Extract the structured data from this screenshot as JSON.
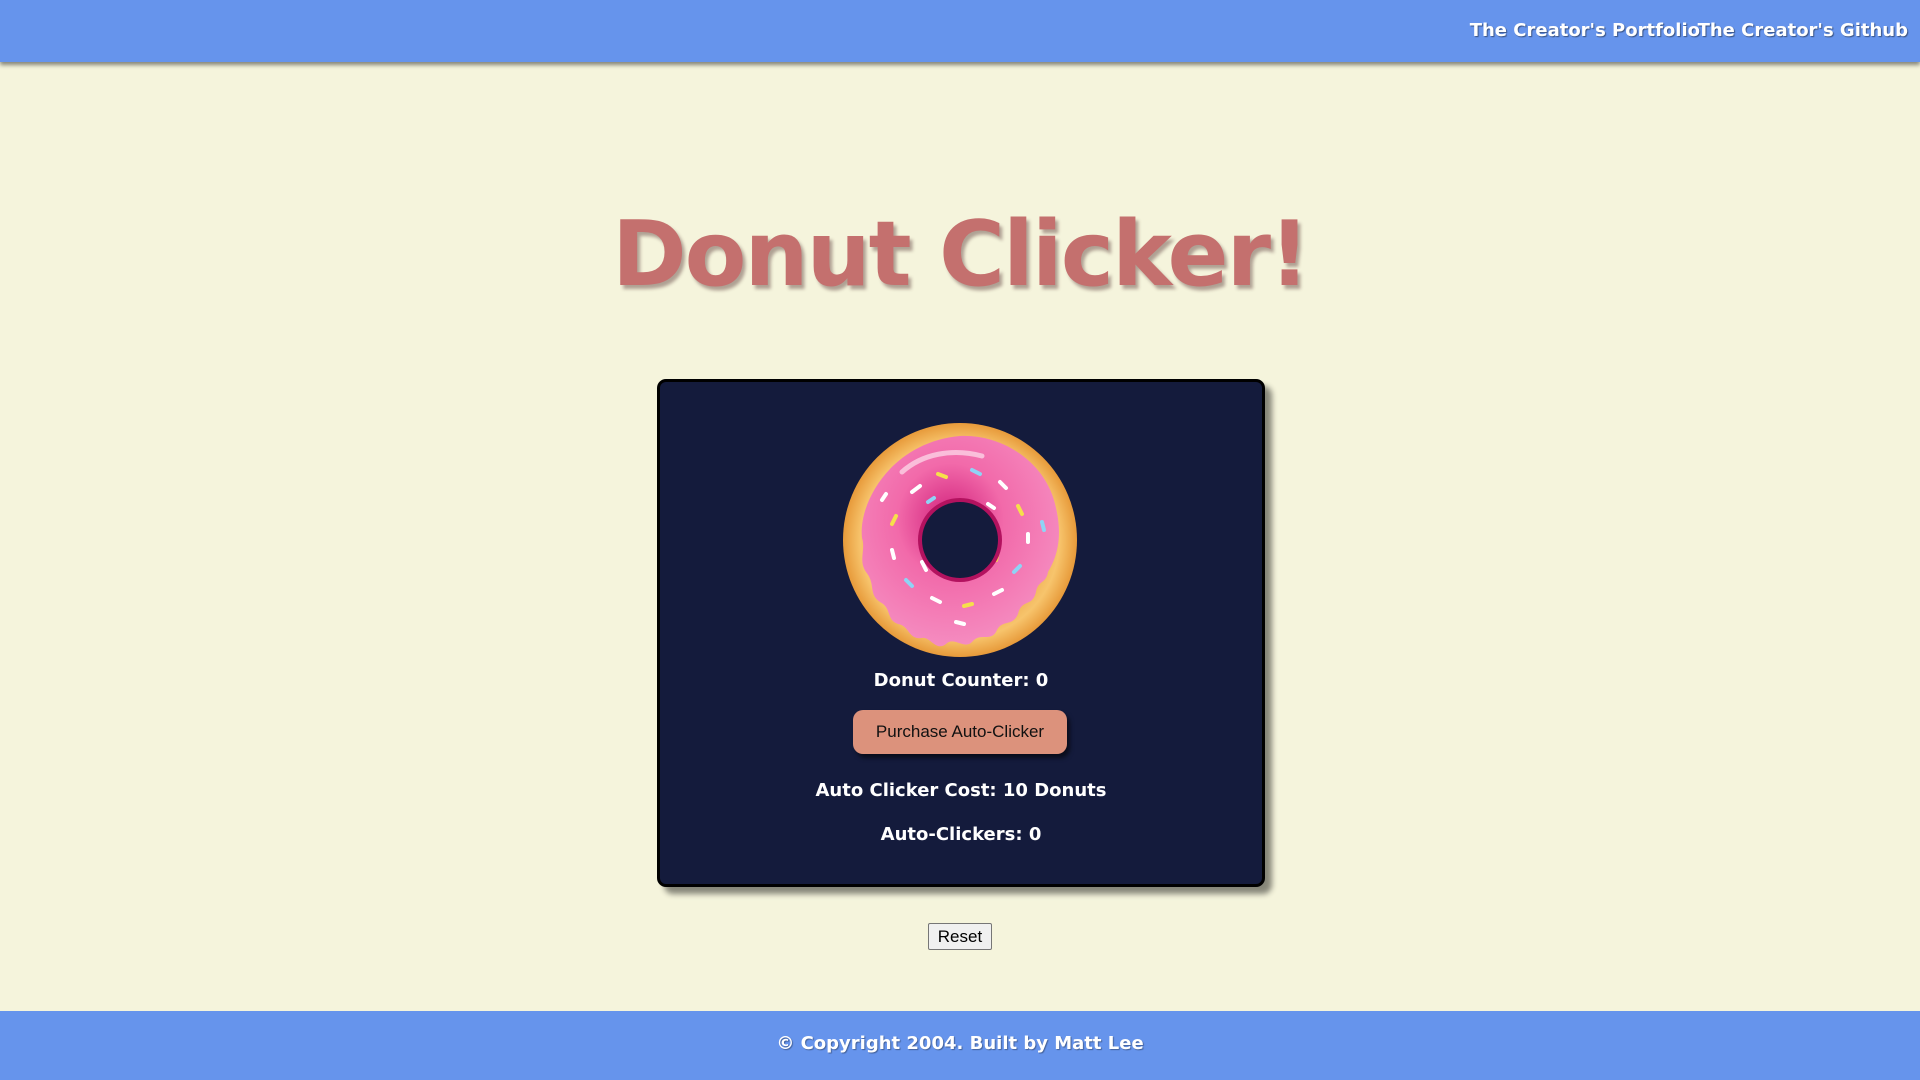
{
  "nav": {
    "portfolio_label": "The Creator's Portfolio",
    "github_label": "The Creator's Github"
  },
  "header": {
    "title": "Donut Clicker!"
  },
  "game": {
    "donut_icon": "donut-icon",
    "counter_text": "Donut Counter: 0",
    "purchase_label": "Purchase Auto-Clicker",
    "cost_text": "Auto Clicker Cost: 10 Donuts",
    "autoclickers_text": "Auto-Clickers: 0"
  },
  "controls": {
    "reset_label": "Reset"
  },
  "footer": {
    "copyright": "© Copyright 2004. Built by Matt Lee"
  },
  "colors": {
    "background": "#f5f4dc",
    "bar": "#6694ec",
    "panel": "#141b3c",
    "title": "#c4706e",
    "purchase_button": "#dc927c",
    "frosting": "#f06aa8",
    "dough": "#f3b659"
  }
}
